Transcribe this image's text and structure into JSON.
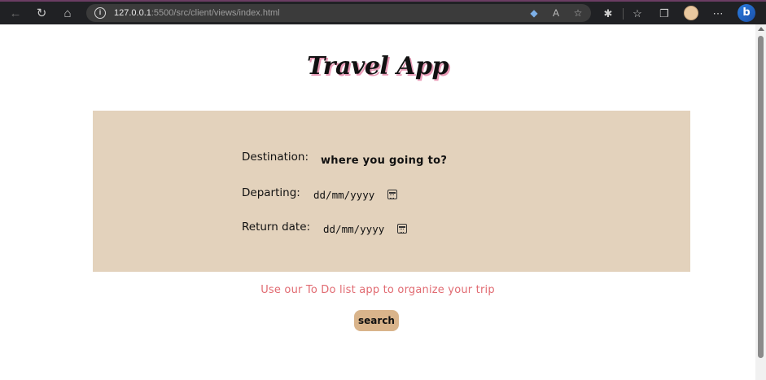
{
  "browser": {
    "url_host": "127.0.0.1",
    "url_path": ":5500/src/client/views/index.html",
    "icons": {
      "back": "arrow-left-icon",
      "reload": "reload-icon",
      "home": "home-icon",
      "info": "info-icon",
      "tracking": "tag-icon",
      "read_aloud": "read-aloud-icon",
      "favorite": "star-add-icon",
      "extensions": "puzzle-icon",
      "favorites": "favorites-icon",
      "collections": "collections-icon",
      "more": "more-icon",
      "copilot": "bing-icon"
    }
  },
  "page": {
    "title": "Travel App",
    "form": {
      "destination_label": "Destination:",
      "destination_placeholder": "where you going to?",
      "departing_label": "Departing:",
      "departing_value": "dd/mm/yyyy",
      "return_label": "Return date:",
      "return_value": "dd/mm/yyyy"
    },
    "todo_link": "Use our To Do list app to organize your trip",
    "search_button": "search"
  },
  "colors": {
    "panel": "#e3d2bc",
    "button": "#d9b48b",
    "link": "#e16b72",
    "title_shadow": "#e89ab6"
  }
}
